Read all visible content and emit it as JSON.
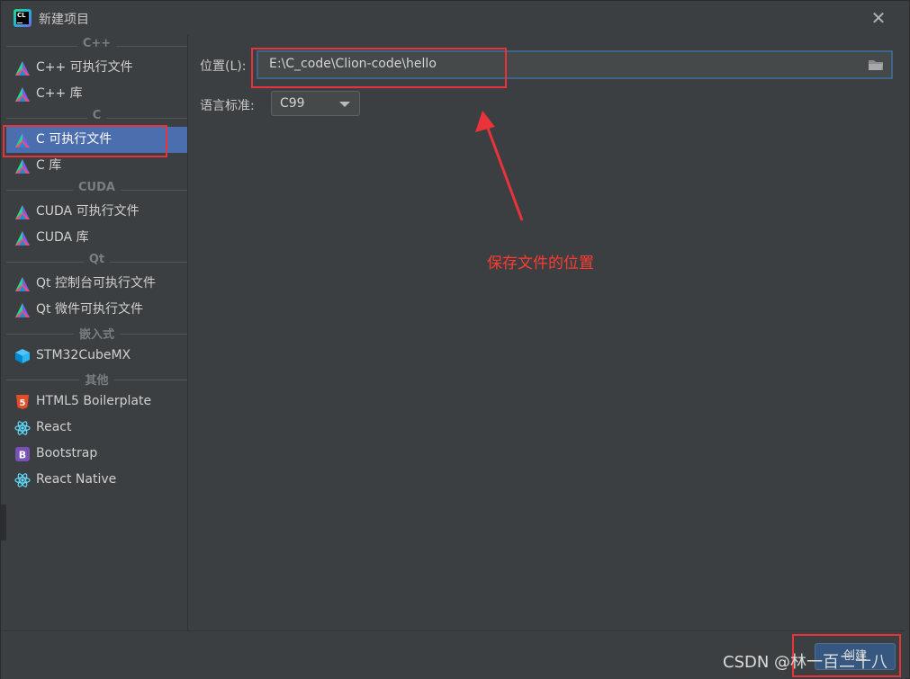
{
  "window": {
    "title": "新建项目"
  },
  "sidebar": {
    "sections": [
      {
        "header": "C++",
        "items": [
          {
            "label": "C++ 可执行文件",
            "icon": "clion-triangle-icon"
          },
          {
            "label": "C++ 库",
            "icon": "clion-triangle-icon"
          }
        ]
      },
      {
        "header": "C",
        "items": [
          {
            "label": "C 可执行文件",
            "icon": "clion-triangle-icon",
            "selected": true
          },
          {
            "label": "C 库",
            "icon": "clion-triangle-icon"
          }
        ]
      },
      {
        "header": "CUDA",
        "items": [
          {
            "label": "CUDA 可执行文件",
            "icon": "clion-triangle-icon"
          },
          {
            "label": "CUDA 库",
            "icon": "clion-triangle-icon"
          }
        ]
      },
      {
        "header": "Qt",
        "items": [
          {
            "label": "Qt 控制台可执行文件",
            "icon": "clion-triangle-icon"
          },
          {
            "label": "Qt 微件可执行文件",
            "icon": "clion-triangle-icon"
          }
        ]
      },
      {
        "header": "嵌入式",
        "items": [
          {
            "label": "STM32CubeMX",
            "icon": "cube-icon"
          }
        ]
      },
      {
        "header": "其他",
        "items": [
          {
            "label": "HTML5 Boilerplate",
            "icon": "html5-icon"
          },
          {
            "label": "React",
            "icon": "react-icon"
          },
          {
            "label": "Bootstrap",
            "icon": "bootstrap-icon"
          },
          {
            "label": "React Native",
            "icon": "react-icon"
          }
        ]
      }
    ]
  },
  "form": {
    "location_label": "位置(L):",
    "location_value": "E:\\C_code\\Clion-code\\hello",
    "language_label": "语言标准:",
    "language_value": "C99"
  },
  "footer": {
    "create_label": "创建"
  },
  "annotation": {
    "text": "保存文件的位置"
  },
  "watermark": {
    "text": "CSDN @林一百二十八"
  },
  "colors": {
    "accent_selected": "#4b6eaf",
    "annotation_red": "#e8333a"
  }
}
